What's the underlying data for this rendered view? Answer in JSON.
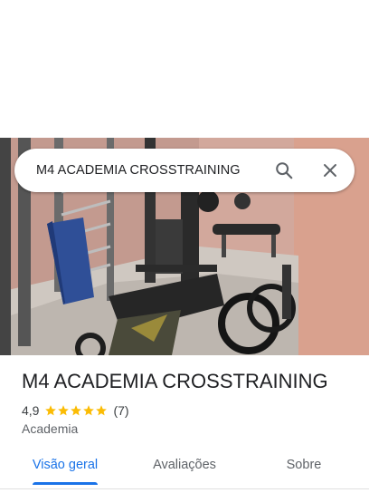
{
  "search": {
    "query": "M4 ACADEMIA CROSSTRAINING"
  },
  "icons": {
    "search": "search-icon",
    "close": "close-icon",
    "star": "star-icon"
  },
  "place": {
    "name": "M4 ACADEMIA CROSSTRAINING",
    "rating": "4,9",
    "stars": 5,
    "reviews": "(7)",
    "category": "Academia"
  },
  "tabs": {
    "overview": "Visão geral",
    "reviews": "Avaliações",
    "about": "Sobre",
    "active": "overview"
  },
  "colors": {
    "accent": "#1a73e8",
    "star": "#fbbc04",
    "title": "#202124",
    "secondary": "#5f6368"
  }
}
